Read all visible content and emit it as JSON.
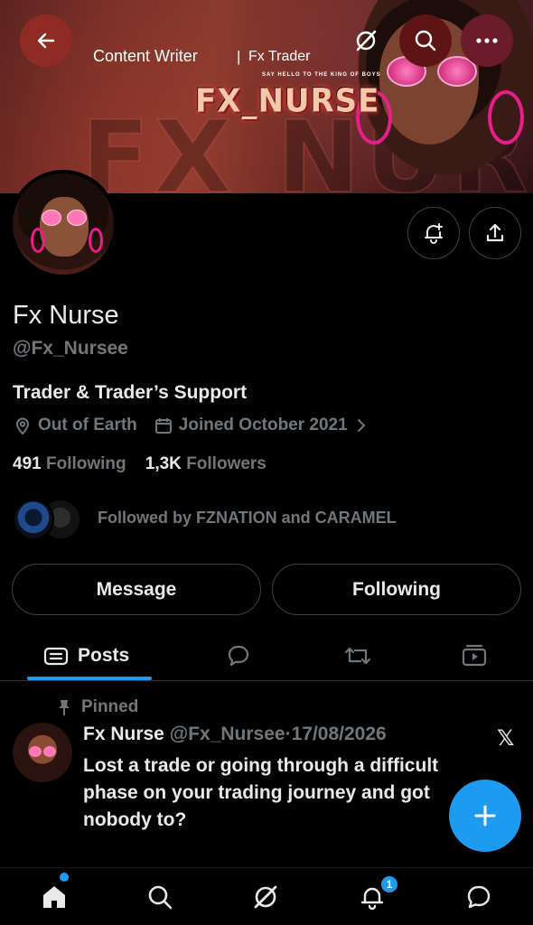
{
  "banner": {
    "title_left": "Content Writer",
    "separator": "|",
    "title_right": "Fx Trader",
    "tagline": "SAY HELLO TO THE KING OF BOYS",
    "logo_text": "FX_NURSE",
    "watermark_text": "FX NURSE"
  },
  "header": {
    "back_icon": "arrow-left-icon",
    "grok_icon": "grok-icon",
    "search_icon": "search-icon",
    "more_icon": "more-horizontal-icon"
  },
  "profile": {
    "name": "Fx Nurse",
    "handle": "@Fx_Nursee",
    "bio": "Trader & Trader’s Support",
    "location": "Out of Earth",
    "joined": "Joined October 2021",
    "following_count": "491",
    "following_label": "Following",
    "followers_count": "1,3K",
    "followers_label": "Followers",
    "followed_by": "Followed by FZNATION and CARAMEL"
  },
  "actions": {
    "message_label": "Message",
    "following_label": "Following"
  },
  "tabs": {
    "posts_label": "Posts"
  },
  "post": {
    "pinned_label": "Pinned",
    "author_name": "Fx Nurse",
    "author_handle": "@Fx_Nursee",
    "separator": "·",
    "date": "17/08/2026",
    "text": "Lost a trade or going through a difficult phase on your trading journey and got nobody to?",
    "source_icon": "x-logo-icon"
  },
  "nav": {
    "notifications_badge": "1"
  },
  "colors": {
    "accent": "#1d9bf0",
    "muted": "#71767b",
    "background": "#000000"
  }
}
